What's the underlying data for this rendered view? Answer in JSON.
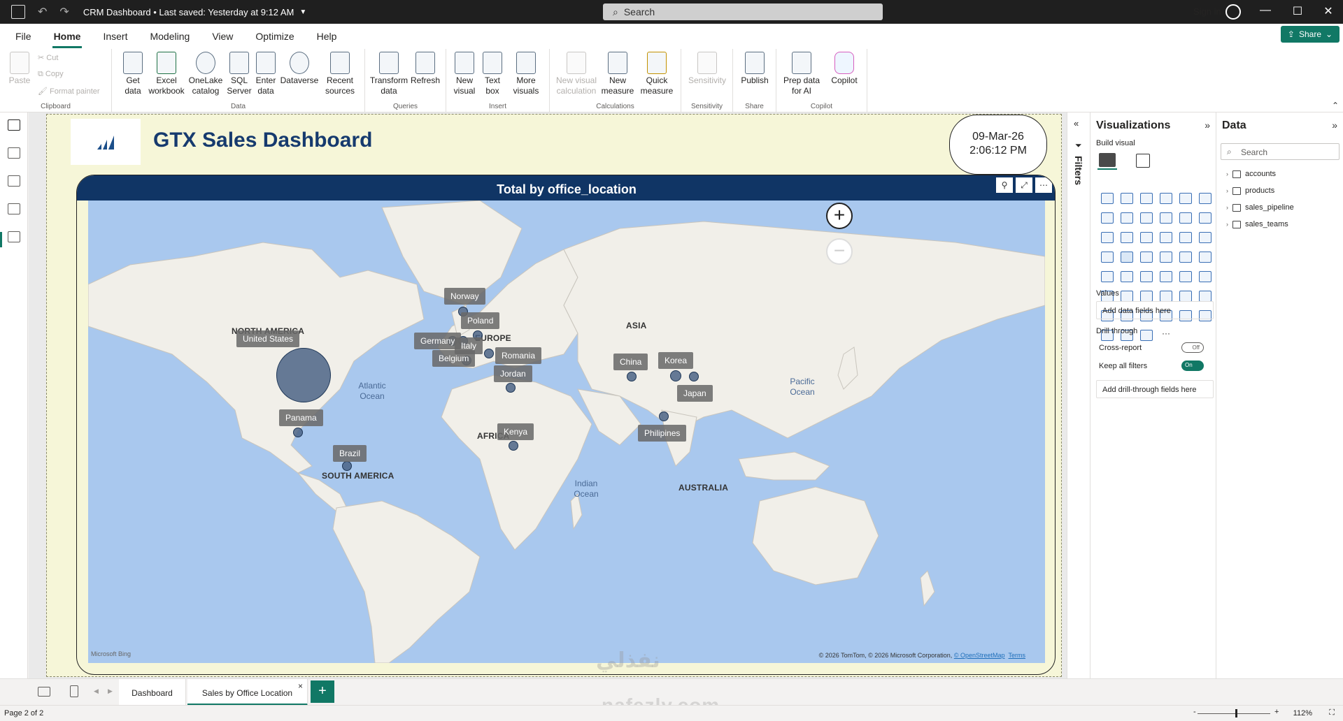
{
  "titlebar": {
    "doc_title": "CRM Dashboard",
    "saved_status": "Last saved: Yesterday at 9:12 AM",
    "search_placeholder": "Search",
    "sign_in": "Sign in"
  },
  "menu": {
    "items": [
      "File",
      "Home",
      "Insert",
      "Modeling",
      "View",
      "Optimize",
      "Help"
    ],
    "active": "Home",
    "share_label": "Share"
  },
  "ribbon": {
    "clipboard": {
      "paste": "Paste",
      "cut": "Cut",
      "copy": "Copy",
      "format_painter": "Format painter",
      "group": "Clipboard"
    },
    "data": {
      "get_data": "Get data",
      "excel": "Excel workbook",
      "onelake": "OneLake catalog",
      "sql": "SQL Server",
      "enter": "Enter data",
      "dataverse": "Dataverse",
      "recent": "Recent sources",
      "group": "Data"
    },
    "queries": {
      "transform": "Transform data",
      "refresh": "Refresh",
      "group": "Queries"
    },
    "insert": {
      "new_visual": "New visual",
      "text_box": "Text box",
      "more_visuals": "More visuals",
      "group": "Insert"
    },
    "calculations": {
      "new_visual_calc": "New visual calculation",
      "new_measure": "New measure",
      "quick_measure": "Quick measure",
      "group": "Calculations"
    },
    "sensitivity": {
      "label": "Sensitivity",
      "group": "Sensitivity"
    },
    "share": {
      "publish": "Publish",
      "group": "Share"
    },
    "copilot": {
      "prep": "Prep data for AI",
      "copilot": "Copilot",
      "group": "Copilot"
    }
  },
  "report": {
    "title": "GTX Sales Dashboard",
    "date": "09-Mar-26",
    "time": "2:06:12 PM",
    "map_title": "Total by office_location",
    "continents": [
      "NORTH AMERICA",
      "SOUTH AMERICA",
      "EUROPE",
      "AFRICA",
      "ASIA",
      "AUSTRALIA"
    ],
    "oceans": {
      "atlantic": "Atlantic Ocean",
      "pacific": "Pacific Ocean",
      "indian": "Indian Ocean"
    },
    "locations": [
      "United States",
      "Norway",
      "Poland",
      "Germany",
      "Italy",
      "Belgium",
      "Romania",
      "Jordan",
      "Panama",
      "Brazil",
      "Kenya",
      "China",
      "Korea",
      "Japan",
      "Philipines"
    ],
    "bing": "Microsoft Bing",
    "attribution": "© 2026 TomTom, © 2026 Microsoft Corporation,",
    "attribution_link": "© OpenStreetMap",
    "terms": "Terms"
  },
  "panes": {
    "filters": "Filters",
    "visualizations": "Visualizations",
    "build_visual": "Build visual",
    "values": "Values",
    "values_well": "Add data fields here",
    "drill_through": "Drill through",
    "cross_report": "Cross-report",
    "cross_report_state": "Off",
    "keep_filters": "Keep all filters",
    "keep_filters_state": "On",
    "drill_well": "Add drill-through fields here",
    "data_title": "Data",
    "data_search": "Search",
    "tables": [
      "accounts",
      "products",
      "sales_pipeline",
      "sales_teams"
    ]
  },
  "tabs": {
    "pages": [
      "Dashboard",
      "Sales by Office Location"
    ],
    "active_index": 1
  },
  "status": {
    "page": "Page 2 of 2",
    "zoom": "112%"
  },
  "watermark": {
    "line1": "نفذلي",
    "line2": "nafezly.com"
  },
  "colors": {
    "accent": "#117865",
    "header_navy": "#103565",
    "title_navy": "#163a6e",
    "page_bg": "#f6f6d8",
    "bubble": "#465f82"
  }
}
